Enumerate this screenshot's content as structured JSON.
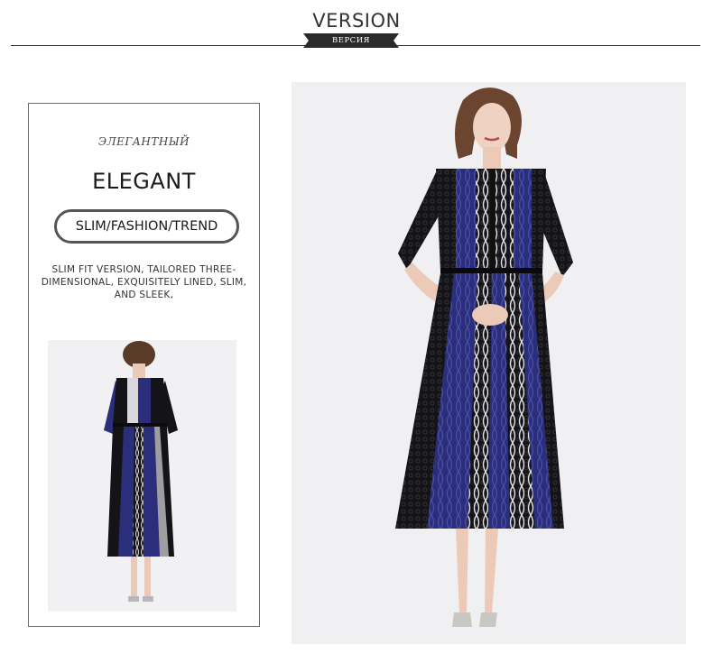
{
  "header": {
    "title": "VERSION",
    "ribbon_label": "ВЕРСИЯ"
  },
  "card": {
    "subtitle": "ЭЛЕГАНТНЫЙ",
    "title": "ELEGANT",
    "tags": "SLIM/FASHION/TREND",
    "description": "SLIM FIT VERSION, TAILORED THREE-DIMENSIONAL, EXQUISITELY LINED, SLIM, AND SLEEK,"
  },
  "colors": {
    "dress_navy": "#2b2e7a",
    "dress_black": "#141418",
    "lace_white": "#d8d8dc",
    "photo_background": "#f0f0f3",
    "rule": "#333333"
  }
}
